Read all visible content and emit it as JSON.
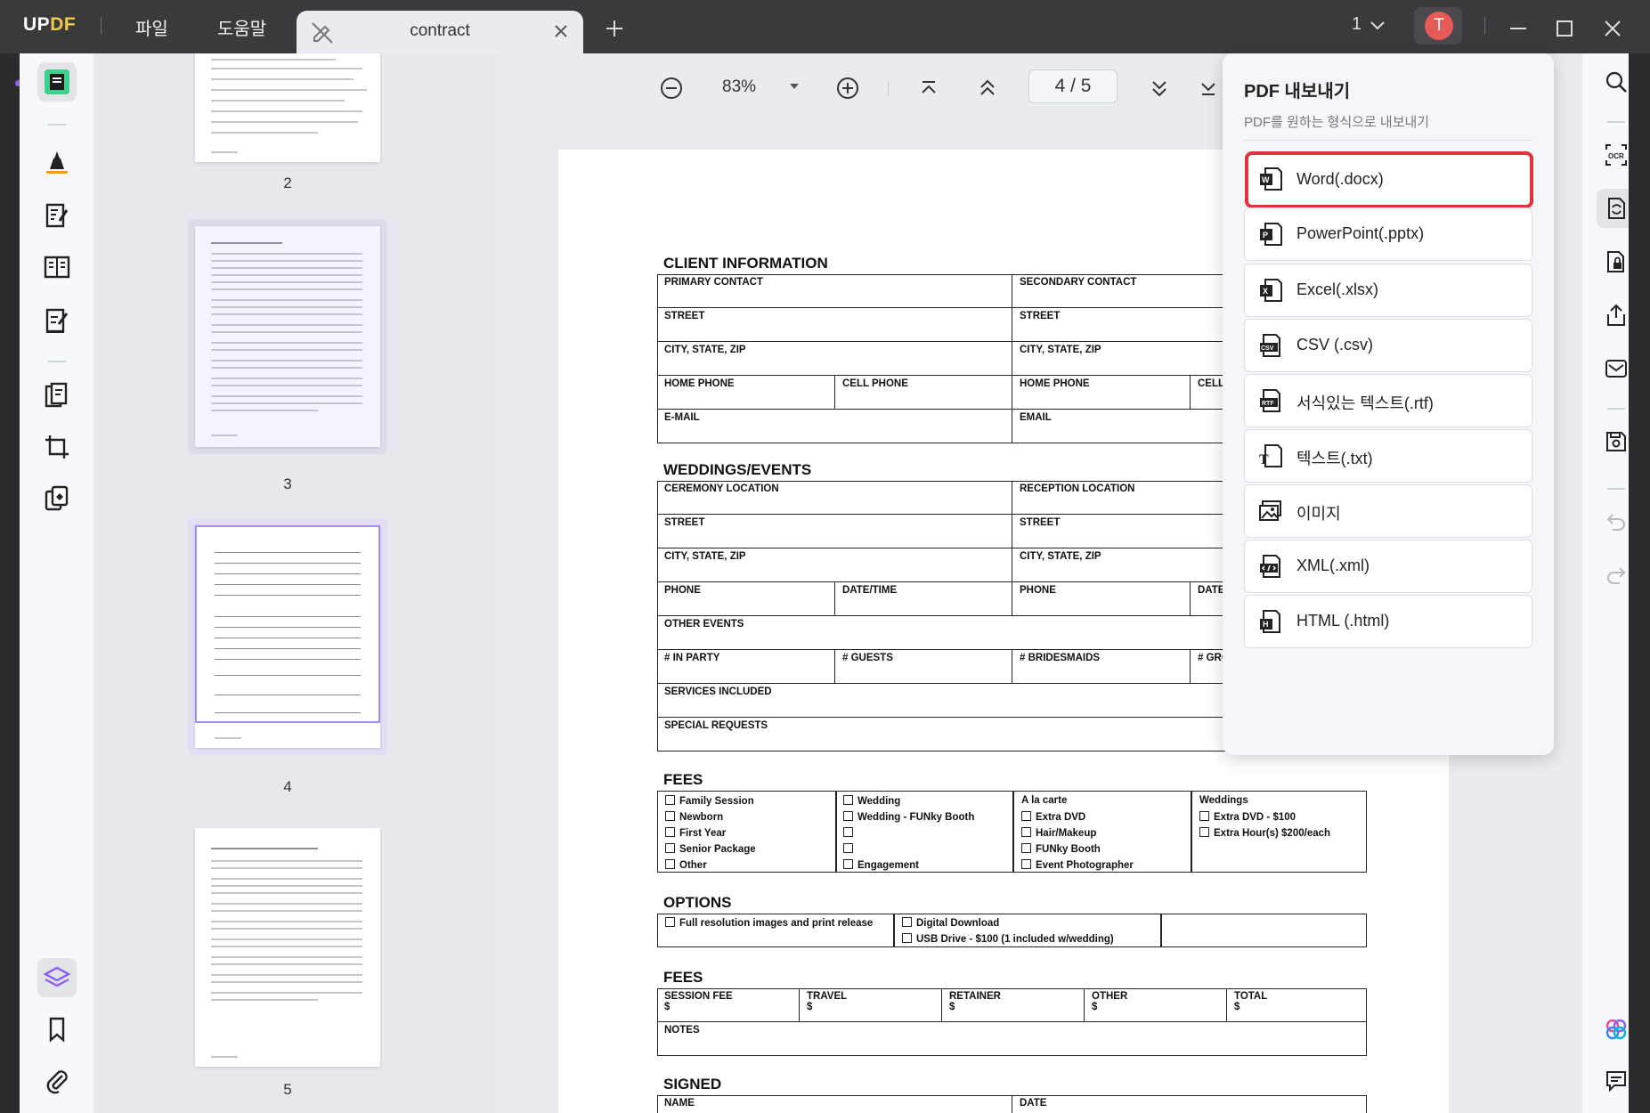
{
  "app": {
    "logo_up": "UP",
    "logo_df": "DF"
  },
  "menu": {
    "file": "파일",
    "help": "도움말"
  },
  "tab": {
    "title": "contract"
  },
  "window": {
    "page_selector": "1",
    "avatar_letter": "T"
  },
  "thumbnails": [
    {
      "number": "2"
    },
    {
      "number": "3"
    },
    {
      "number": "4"
    },
    {
      "number": "5"
    }
  ],
  "toolbar": {
    "zoom": "83%",
    "page_indicator": "4 / 5"
  },
  "document": {
    "client": {
      "title": "CLIENT INFORMATION",
      "primary_contact": "PRIMARY CONTACT",
      "secondary_contact": "SECONDARY CONTACT",
      "street_l": "STREET",
      "street_r": "STREET",
      "city_l": "CITY, STATE, ZIP",
      "city_r": "CITY, STATE, ZIP",
      "home_l": "HOME PHONE",
      "cell_l": "CELL PHONE",
      "home_r": "HOME PHONE",
      "cell_r": "CELL",
      "email_l": "E-MAIL",
      "email_r": "EMAIL"
    },
    "weddings": {
      "title": "WEDDINGS/EVENTS",
      "ceremony": "CEREMONY LOCATION",
      "reception": "RECEPTION LOCATION",
      "street_l": "STREET",
      "street_r": "STREET",
      "city_l": "CITY, STATE, ZIP",
      "city_r": "CITY, STATE, ZIP",
      "phone_l": "PHONE",
      "datetime": "DATE/TIME",
      "phone_r": "PHONE",
      "date_r": "DATE",
      "other_events": "OTHER EVENTS",
      "in_party": "# IN PARTY",
      "guests": "# GUESTS",
      "bridesmaids": "# BRIDESMAIDS",
      "groomsmen": "# GRO",
      "services": "SERVICES INCLUDED",
      "special": "SPECIAL REQUESTS"
    },
    "fees": {
      "title": "FEES",
      "col1": [
        "Family Session",
        "Newborn",
        "First Year",
        "Senior Package",
        "Other"
      ],
      "col2": [
        "Wedding",
        "Wedding - FUNky Booth",
        "",
        "",
        "Engagement"
      ],
      "col3_header": "A la carte",
      "col3": [
        "Extra DVD",
        "Hair/Makeup",
        "FUNky Booth",
        "Event Photographer"
      ],
      "col4_header": "Weddings",
      "col4": [
        "Extra DVD - $100",
        "Extra Hour(s) $200/each"
      ]
    },
    "options": {
      "title": "OPTIONS",
      "full_res": "Full resolution images and print release",
      "digital": "Digital Download",
      "usb": "USB Drive - $100 (1 included w/wedding)"
    },
    "fees2": {
      "title": "FEES",
      "session": "SESSION FEE",
      "travel": "TRAVEL",
      "retainer": "RETAINER",
      "other": "OTHER",
      "total": "TOTAL",
      "dollar": "$",
      "notes": "NOTES"
    },
    "signed": {
      "title": "SIGNED",
      "name": "NAME",
      "date": "DATE"
    }
  },
  "export": {
    "title": "PDF 내보내기",
    "subtitle": "PDF를 원하는 형식으로 내보내기",
    "items": [
      {
        "label": "Word(.docx)",
        "icon": "word-icon"
      },
      {
        "label": "PowerPoint(.pptx)",
        "icon": "powerpoint-icon"
      },
      {
        "label": "Excel(.xlsx)",
        "icon": "excel-icon"
      },
      {
        "label": "CSV (.csv)",
        "icon": "csv-icon"
      },
      {
        "label": "서식있는 텍스트(.rtf)",
        "icon": "rtf-icon"
      },
      {
        "label": "텍스트(.txt)",
        "icon": "txt-icon"
      },
      {
        "label": "이미지",
        "icon": "image-icon"
      },
      {
        "label": "XML(.xml)",
        "icon": "xml-icon"
      },
      {
        "label": "HTML (.html)",
        "icon": "html-icon"
      }
    ]
  },
  "colors": {
    "accent": "#8b5cf6",
    "highlight": "#e0333e",
    "titlebar": "#3a3a3d"
  }
}
